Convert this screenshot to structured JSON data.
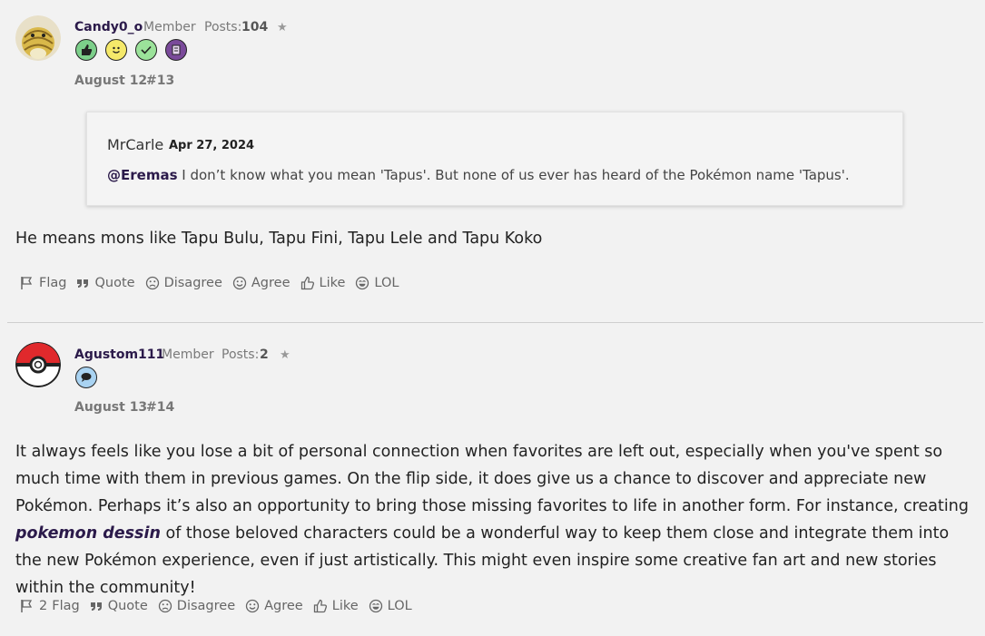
{
  "posts": [
    {
      "username": "Candy0_o",
      "role": "Member",
      "posts_label": "Posts:",
      "posts_count": "104",
      "star": "★",
      "avatar": "sandshrew-avatar",
      "badges": [
        "thumbs-up-badge",
        "smiley-badge",
        "checkmark-badge",
        "book-badge"
      ],
      "date": "August 12",
      "number": "#13",
      "quote": {
        "author": "MrCarle",
        "date": "Apr 27, 2024",
        "mention": "@Eremas",
        "text": " I don’t know what you mean 'Tapus'. But none of us ever has heard of the Pokémon name 'Tapus'."
      },
      "body": "He means mons like Tapu Bulu, Tapu Fini, Tapu Lele and Tapu Koko",
      "actions": {
        "count": "",
        "flag": "Flag",
        "quote": "Quote",
        "disagree": "Disagree",
        "agree": "Agree",
        "like": "Like",
        "lol": "LOL"
      }
    },
    {
      "username": "Agustom111",
      "role": "Member",
      "posts_label": "Posts:",
      "posts_count": "2",
      "star": "★",
      "avatar": "pokeball-avatar",
      "badges": [
        "speech-bubble-badge"
      ],
      "date": "August 13",
      "number": "#14",
      "body_before": "It always feels like you lose a bit of personal connection when favorites are left out, especially when you've spent so much time with them in previous games. On the flip side, it does give us a chance to discover and appreciate new Pokémon. Perhaps it’s also an opportunity to bring those missing favorites to life in another form. For instance, creating ",
      "body_link": "pokemon dessin",
      "body_after": " of those beloved characters could be a wonderful way to keep them close and integrate them into the new Pokémon experience, even if just artistically. This might even inspire some creative fan art and new stories within the community!",
      "actions": {
        "count": "2",
        "flag": "Flag",
        "quote": "Quote",
        "disagree": "Disagree",
        "agree": "Agree",
        "like": "Like",
        "lol": "LOL"
      }
    }
  ],
  "colors": {
    "username": "#2b1a4a",
    "background": "#f2f2f2",
    "badge_green": "#7ccf8a",
    "badge_yellow": "#f5e96a",
    "badge_purple": "#7a4a9a",
    "badge_blue": "#a9d3f2"
  }
}
